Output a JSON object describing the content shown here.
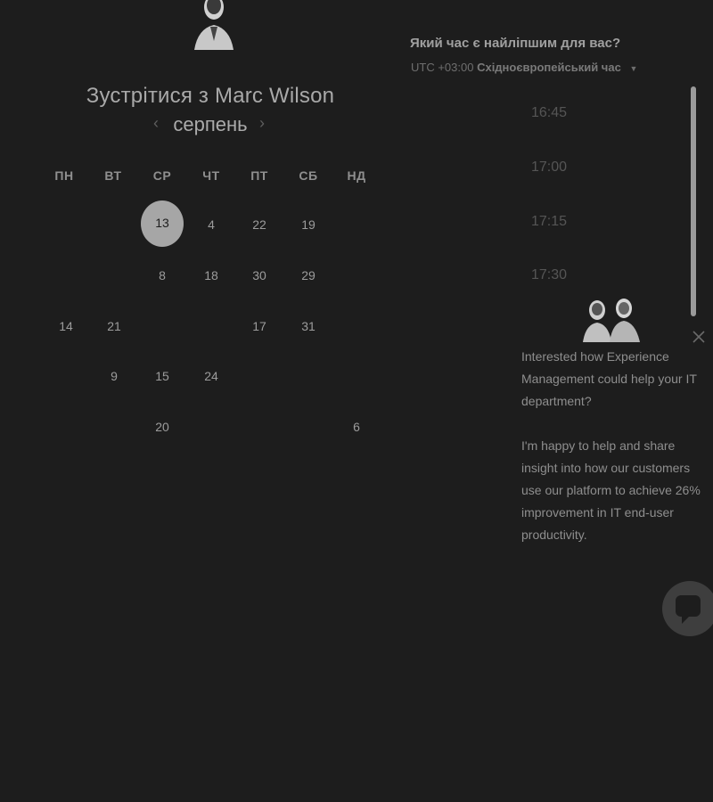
{
  "header": {
    "title": "Зустрітися з Marc Wilson",
    "avatar_icon": "person-avatar-icon"
  },
  "calendar": {
    "month": "серпень",
    "prev_icon": "chevron-left-icon",
    "next_icon": "chevron-right-icon",
    "weekdays": [
      "ПН",
      "ВТ",
      "СР",
      "ЧТ",
      "ПТ",
      "СБ",
      "НД"
    ],
    "weeks": [
      [
        "",
        "",
        "13",
        "4",
        "22",
        "19",
        ""
      ],
      [
        "",
        "",
        "8",
        "18",
        "30",
        "29",
        ""
      ],
      [
        "14",
        "21",
        "",
        "",
        "17",
        "31",
        ""
      ],
      [
        "",
        "9",
        "15",
        "24",
        "",
        "",
        ""
      ],
      [
        "",
        "",
        "20",
        "",
        "",
        "",
        "6"
      ]
    ],
    "selected": "13"
  },
  "timezone": {
    "question": "Який час є найліпшим для вас?",
    "offset": "UTC +03:00",
    "name": "Східноєвропейський час"
  },
  "slots": [
    "16:45",
    "17:00",
    "17:15",
    "17:30"
  ],
  "popup": {
    "faces_icon": "team-avatars-icon",
    "close_icon": "close-icon",
    "paragraph1": "Interested how Experience Management could help your IT department?",
    "paragraph2": "I'm happy to help and share insight into how our customers use our platform to achieve 26% improvement in IT end-user productivity."
  },
  "chat": {
    "icon": "chat-bubble-icon"
  },
  "colors": {
    "background": "#1d1d1d",
    "selected_day": "#a6a6a6"
  }
}
